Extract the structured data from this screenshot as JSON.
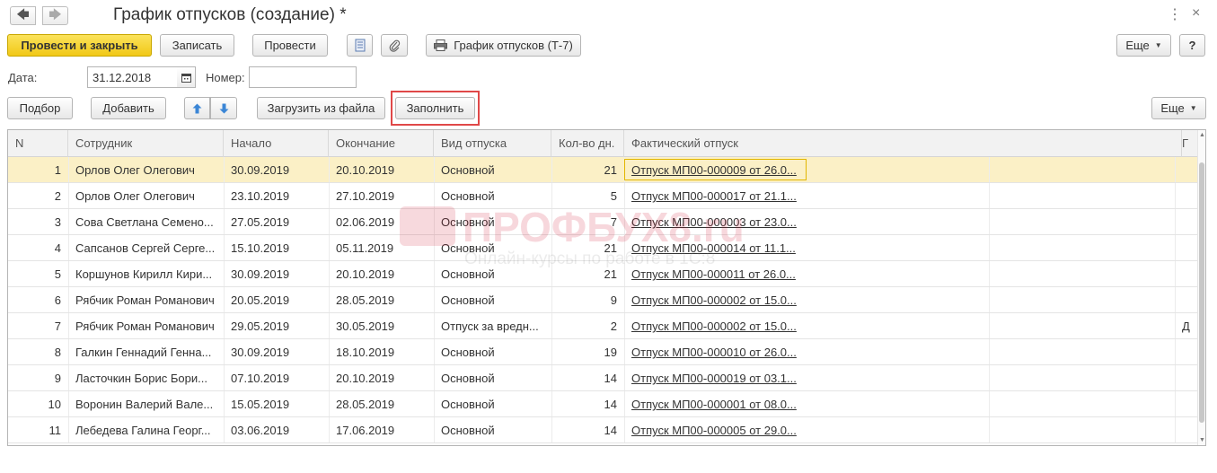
{
  "window": {
    "title": "График отпусков (создание) *",
    "back_icon": "arrow-left",
    "forward_icon": "arrow-right",
    "more_icon": "⋮",
    "close_icon": "×"
  },
  "toolbar": {
    "post_close": "Провести и закрыть",
    "save": "Записать",
    "post": "Провести",
    "print_report": "График отпусков (Т-7)",
    "more": "Еще",
    "help": "?"
  },
  "form": {
    "date_label": "Дата:",
    "date_value": "31.12.2018",
    "number_label": "Номер:",
    "number_value": ""
  },
  "table_toolbar": {
    "select": "Подбор",
    "add": "Добавить",
    "load_from_file": "Загрузить из файла",
    "fill": "Заполнить",
    "more": "Еще"
  },
  "table": {
    "columns": [
      "N",
      "Сотрудник",
      "Начало",
      "Окончание",
      "Вид отпуска",
      "Кол-во дн.",
      "Фактический отпуск",
      "Г"
    ],
    "rows": [
      {
        "n": "1",
        "employee": "Орлов Олег Олегович",
        "start": "30.09.2019",
        "end": "20.10.2019",
        "type": "Основной",
        "days": "21",
        "actual": "Отпуск МП00-000009 от 26.0...",
        "extra": ""
      },
      {
        "n": "2",
        "employee": "Орлов Олег Олегович",
        "start": "23.10.2019",
        "end": "27.10.2019",
        "type": "Основной",
        "days": "5",
        "actual": "Отпуск МП00-000017 от 21.1...",
        "extra": ""
      },
      {
        "n": "3",
        "employee": "Сова Светлана Семено...",
        "start": "27.05.2019",
        "end": "02.06.2019",
        "type": "Основной",
        "days": "7",
        "actual": "Отпуск МП00-000003 от 23.0...",
        "extra": ""
      },
      {
        "n": "4",
        "employee": "Сапсанов Сергей Серге...",
        "start": "15.10.2019",
        "end": "05.11.2019",
        "type": "Основной",
        "days": "21",
        "actual": "Отпуск МП00-000014 от 11.1...",
        "extra": ""
      },
      {
        "n": "5",
        "employee": "Коршунов Кирилл Кири...",
        "start": "30.09.2019",
        "end": "20.10.2019",
        "type": "Основной",
        "days": "21",
        "actual": "Отпуск МП00-000011 от 26.0...",
        "extra": ""
      },
      {
        "n": "6",
        "employee": "Рябчик Роман Романович",
        "start": "20.05.2019",
        "end": "28.05.2019",
        "type": "Основной",
        "days": "9",
        "actual": "Отпуск МП00-000002 от 15.0...",
        "extra": ""
      },
      {
        "n": "7",
        "employee": "Рябчик Роман Романович",
        "start": "29.05.2019",
        "end": "30.05.2019",
        "type": "Отпуск за вредн...",
        "days": "2",
        "actual": "Отпуск МП00-000002 от 15.0...",
        "extra": "Д"
      },
      {
        "n": "8",
        "employee": "Галкин Геннадий Генна...",
        "start": "30.09.2019",
        "end": "18.10.2019",
        "type": "Основной",
        "days": "19",
        "actual": "Отпуск МП00-000010 от 26.0...",
        "extra": ""
      },
      {
        "n": "9",
        "employee": "Ласточкин Борис Бори...",
        "start": "07.10.2019",
        "end": "20.10.2019",
        "type": "Основной",
        "days": "14",
        "actual": "Отпуск МП00-000019 от 03.1...",
        "extra": ""
      },
      {
        "n": "10",
        "employee": "Воронин Валерий Вале...",
        "start": "15.05.2019",
        "end": "28.05.2019",
        "type": "Основной",
        "days": "14",
        "actual": "Отпуск МП00-000001 от 08.0...",
        "extra": ""
      },
      {
        "n": "11",
        "employee": "Лебедева Галина Георг...",
        "start": "03.06.2019",
        "end": "17.06.2019",
        "type": "Основной",
        "days": "14",
        "actual": "Отпуск МП00-000005 от 29.0...",
        "extra": ""
      }
    ]
  },
  "watermark": {
    "main": "ПРОФБУХ8.ru",
    "sub": "Онлайн-курсы по работе в 1С:8"
  },
  "colors": {
    "primary_button": "#f5d226",
    "selected_row": "#fbf0c6",
    "highlight_border": "#e04848"
  }
}
